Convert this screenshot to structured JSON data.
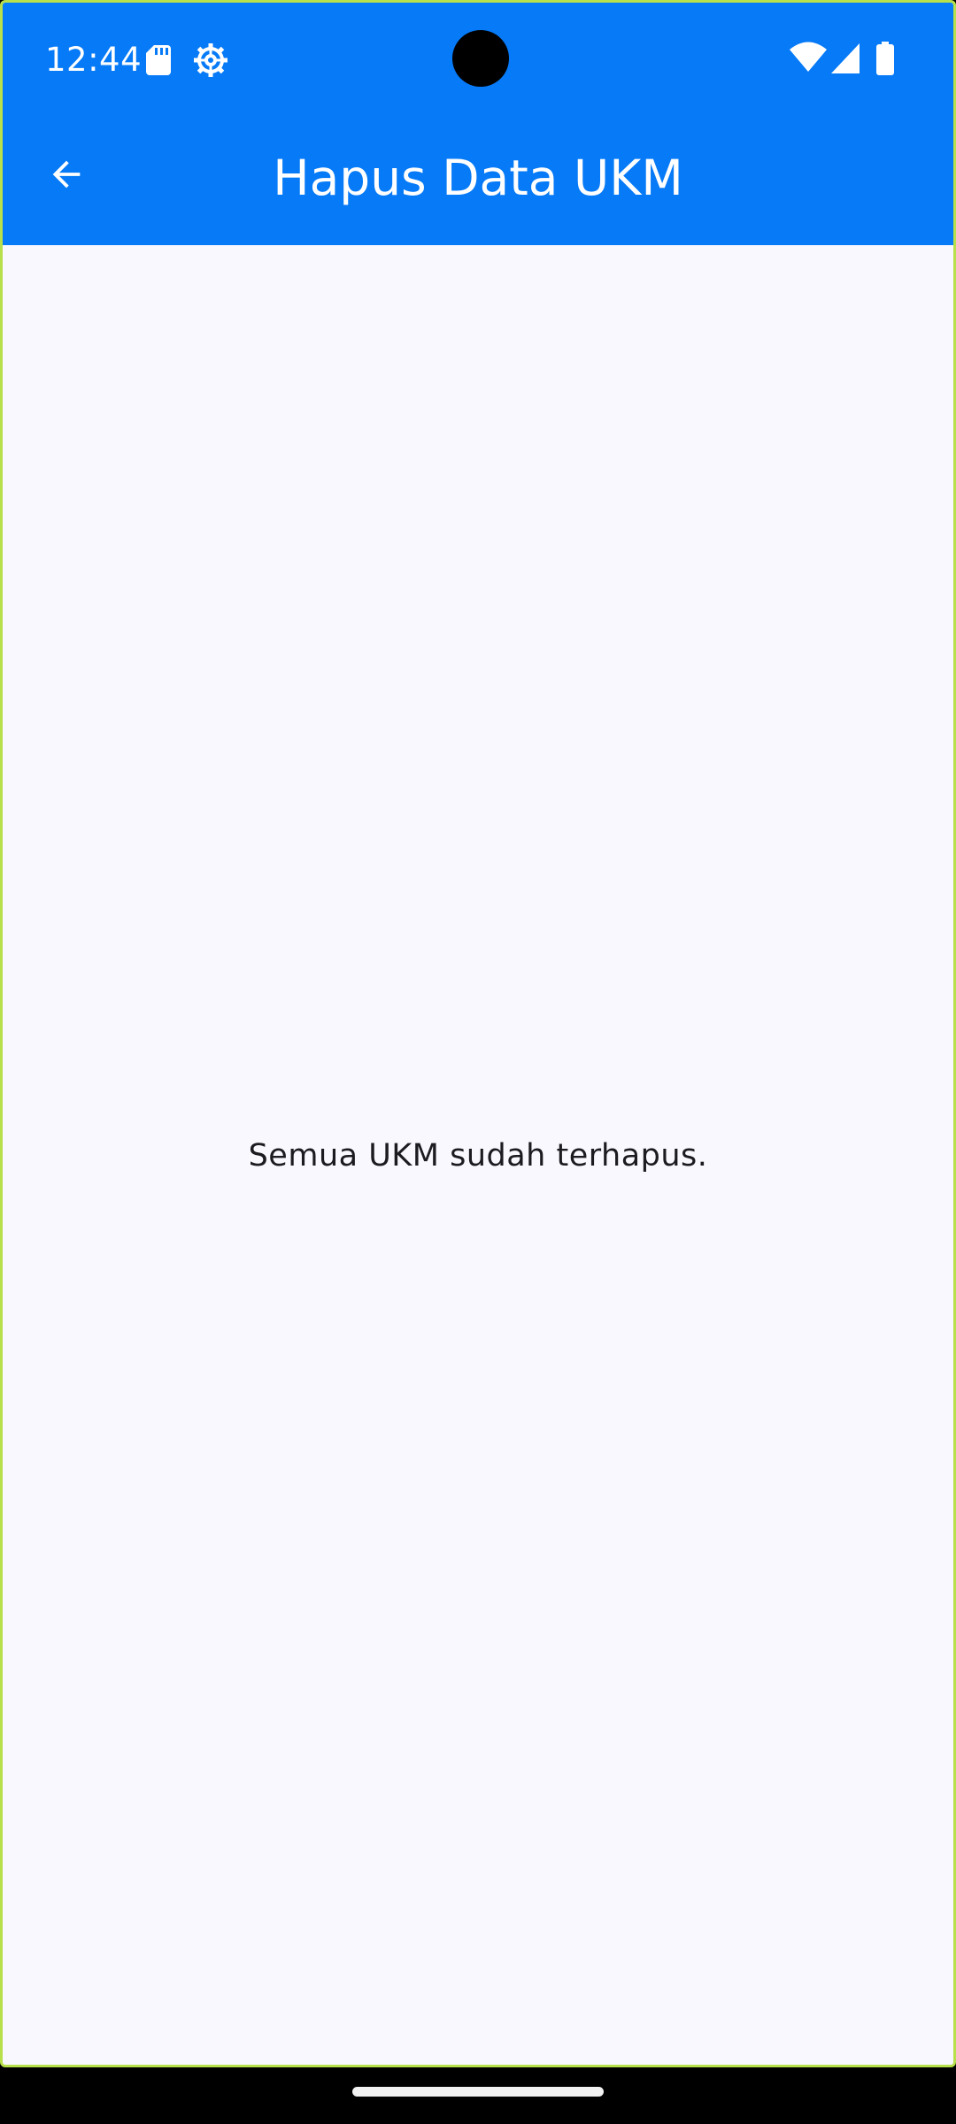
{
  "status_bar": {
    "time": "12:44",
    "icons": [
      "sd-card-icon",
      "gear-icon",
      "wifi-icon",
      "signal-icon",
      "battery-icon"
    ]
  },
  "app_bar": {
    "title": "Hapus Data UKM",
    "back_icon": "arrow-left-icon",
    "background_color": "#067af7"
  },
  "main": {
    "empty_message": "Semua UKM sudah terhapus.",
    "background_color": "#f8f8fe"
  },
  "nav_bar": {
    "handle_icon": "home-handle"
  }
}
